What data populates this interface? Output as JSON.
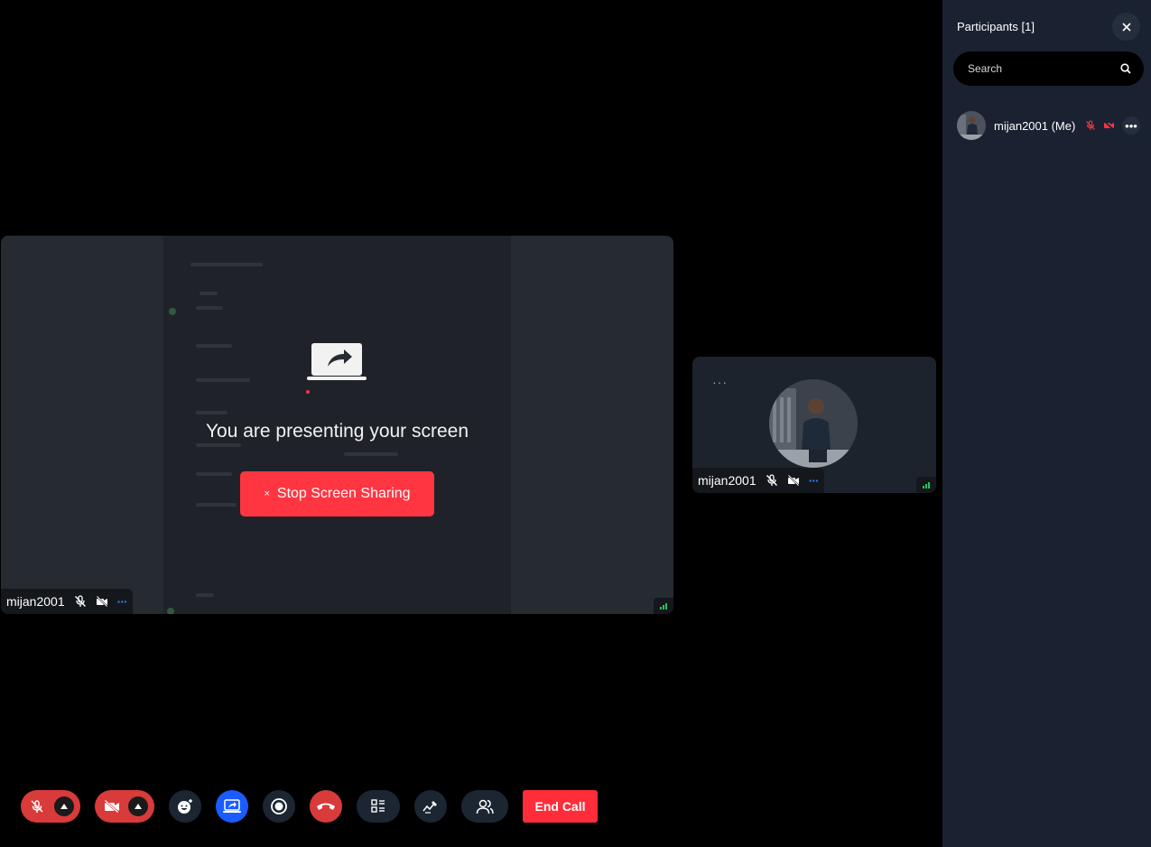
{
  "presenter": {
    "message": "You are presenting your screen",
    "stop_label": "Stop Screen Sharing",
    "stop_icon": "×",
    "name": "mijan2001"
  },
  "self_tile": {
    "name": "mijan2001",
    "more": "···"
  },
  "toolbar": {
    "end_call_label": "End Call",
    "colors": {
      "danger": "#d93a3a",
      "active": "#1a5cff",
      "neutral": "#1c2633",
      "end": "#ff2d3a"
    },
    "icons": [
      "mic-off-icon",
      "camera-off-icon",
      "emoji-add-icon",
      "screen-share-icon",
      "record-icon",
      "hang-up-icon",
      "layout-icon",
      "whiteboard-icon",
      "participants-icon"
    ]
  },
  "sidebar": {
    "title": "Participants [1]",
    "search_placeholder": "Search",
    "participants": [
      {
        "name": "mijan2001 (Me)",
        "mic": "off",
        "camera": "off"
      }
    ]
  }
}
